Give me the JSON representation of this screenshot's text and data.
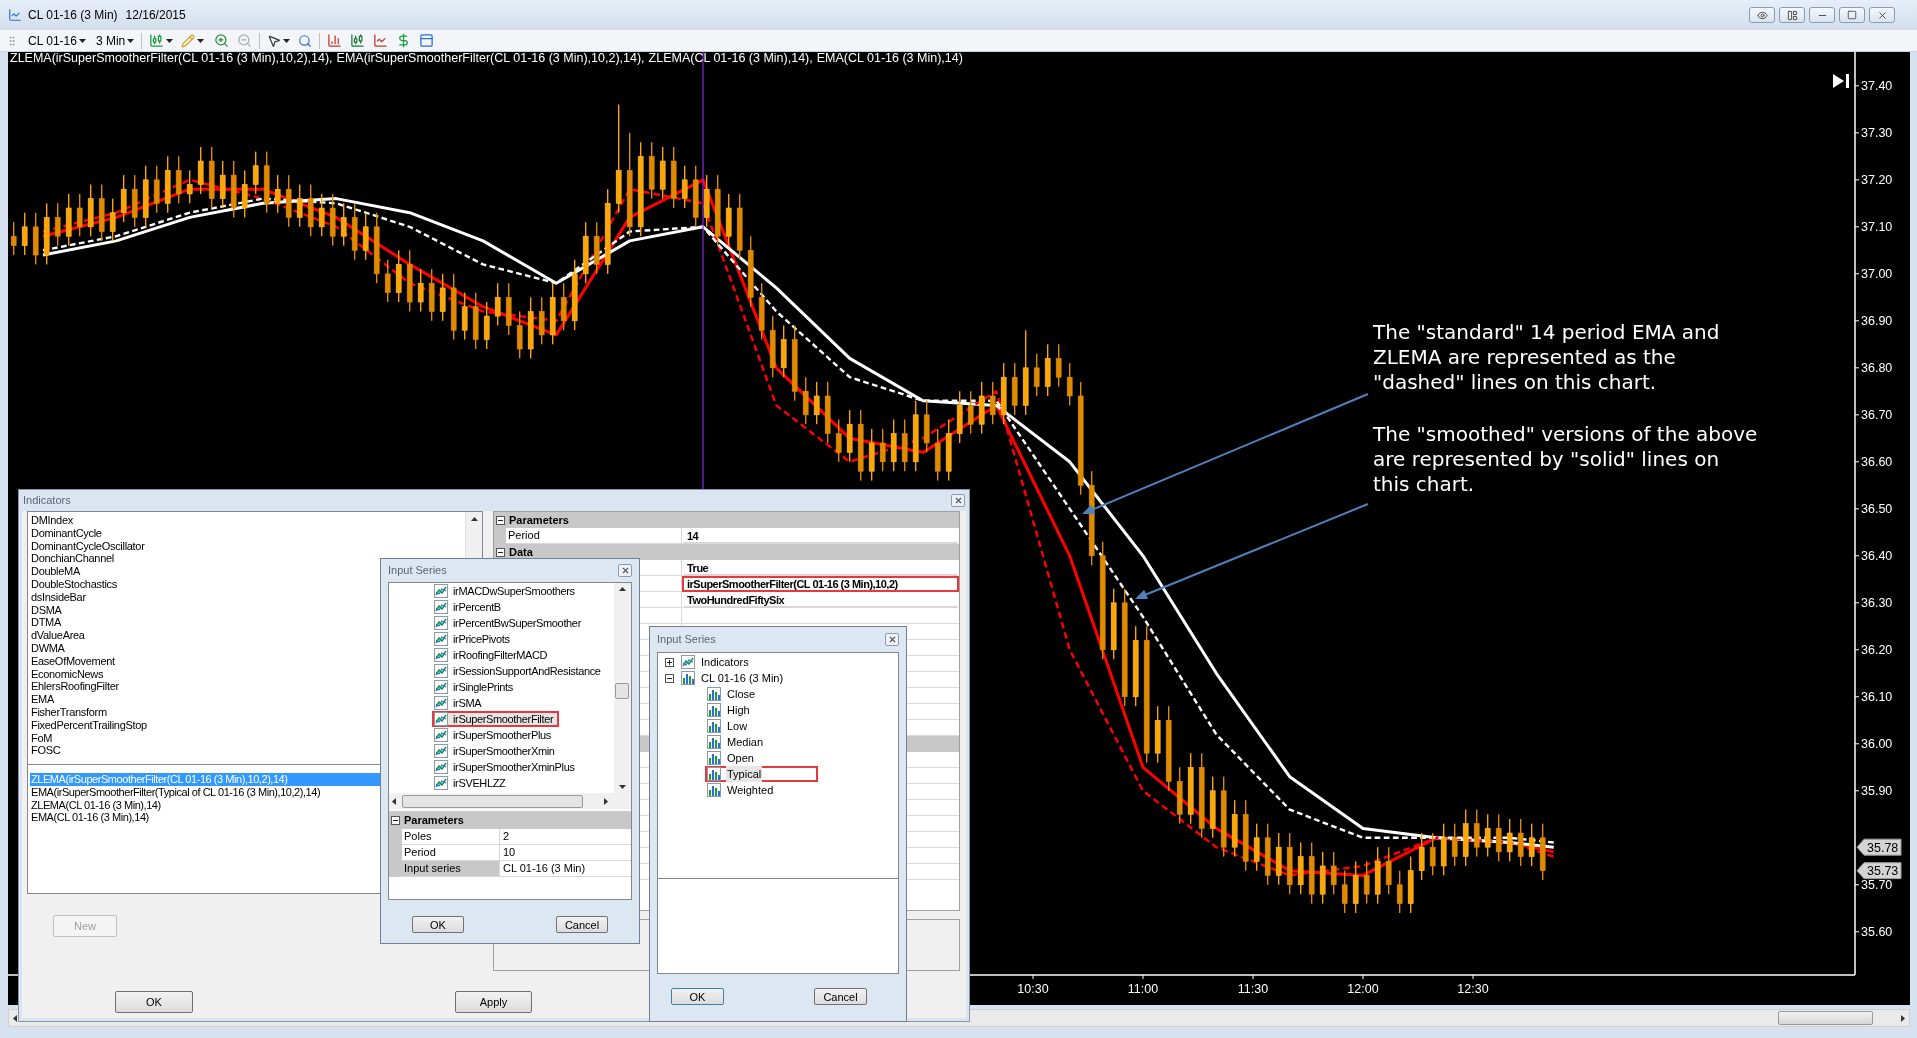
{
  "window": {
    "title": "CL 01-16 (3 Min)",
    "date": "12/16/2015"
  },
  "toolbar": {
    "instrument": "CL 01-16",
    "interval": "3 Min"
  },
  "chart": {
    "legend_separator": ",",
    "chart_data": {
      "type": "candlestick",
      "x": [
        352,
        355,
        358,
        361,
        364,
        367,
        370,
        373,
        376,
        379,
        382,
        385,
        388,
        391,
        394,
        397,
        400,
        403,
        406,
        409,
        412,
        415,
        418,
        421,
        424,
        427,
        430,
        433,
        436,
        439,
        442,
        445,
        448,
        451,
        454,
        457,
        460,
        463,
        466,
        469,
        472,
        475,
        478,
        481,
        484,
        487,
        490,
        493,
        496,
        499,
        502,
        505,
        508,
        511,
        514,
        517,
        520,
        523,
        526,
        529,
        532,
        535,
        538,
        541,
        544,
        547,
        550,
        553,
        556,
        559,
        562,
        565,
        568,
        571,
        574,
        577,
        580,
        583,
        586,
        589,
        592,
        595,
        598,
        601,
        604,
        607,
        610,
        613,
        616,
        619,
        622,
        625,
        628,
        631,
        634,
        637,
        640,
        643,
        646,
        649,
        652,
        655,
        658,
        661,
        664,
        667,
        670,
        673,
        676,
        679,
        682,
        685,
        688,
        691,
        694,
        697,
        700,
        703,
        706,
        709,
        712,
        715,
        718,
        721,
        724,
        727,
        730,
        733,
        736,
        739,
        742,
        745,
        748,
        751,
        754,
        757,
        760,
        763,
        766,
        769
      ],
      "ohlc": [
        [
          37.08,
          37.11,
          37.04,
          37.06
        ],
        [
          37.06,
          37.13,
          37.04,
          37.1
        ],
        [
          37.1,
          37.13,
          37.02,
          37.04
        ],
        [
          37.04,
          37.15,
          37.02,
          37.12
        ],
        [
          37.12,
          37.15,
          37.06,
          37.08
        ],
        [
          37.08,
          37.17,
          37.06,
          37.14
        ],
        [
          37.14,
          37.17,
          37.08,
          37.1
        ],
        [
          37.1,
          37.19,
          37.08,
          37.16
        ],
        [
          37.16,
          37.19,
          37.07,
          37.09
        ],
        [
          37.09,
          37.16,
          37.07,
          37.13
        ],
        [
          37.13,
          37.21,
          37.11,
          37.18
        ],
        [
          37.18,
          37.21,
          37.1,
          37.12
        ],
        [
          37.12,
          37.23,
          37.1,
          37.2
        ],
        [
          37.2,
          37.23,
          37.13,
          37.15
        ],
        [
          37.15,
          37.25,
          37.13,
          37.22
        ],
        [
          37.22,
          37.25,
          37.15,
          37.17
        ],
        [
          37.17,
          37.22,
          37.15,
          37.19
        ],
        [
          37.19,
          37.27,
          37.17,
          37.24
        ],
        [
          37.24,
          37.27,
          37.14,
          37.16
        ],
        [
          37.16,
          37.24,
          37.14,
          37.21
        ],
        [
          37.21,
          37.24,
          37.12,
          37.14
        ],
        [
          37.14,
          37.22,
          37.12,
          37.19
        ],
        [
          37.19,
          37.26,
          37.17,
          37.23
        ],
        [
          37.23,
          37.26,
          37.13,
          37.15
        ],
        [
          37.15,
          37.21,
          37.13,
          37.18
        ],
        [
          37.18,
          37.21,
          37.1,
          37.12
        ],
        [
          37.12,
          37.19,
          37.1,
          37.16
        ],
        [
          37.16,
          37.19,
          37.08,
          37.1
        ],
        [
          37.1,
          37.17,
          37.08,
          37.14
        ],
        [
          37.14,
          37.17,
          37.06,
          37.08
        ],
        [
          37.08,
          37.15,
          37.06,
          37.12
        ],
        [
          37.12,
          37.15,
          37.03,
          37.05
        ],
        [
          37.05,
          37.13,
          37.03,
          37.1
        ],
        [
          37.1,
          37.13,
          36.98,
          37.0
        ],
        [
          37.0,
          37.03,
          36.94,
          36.96
        ],
        [
          36.96,
          37.05,
          36.94,
          37.02
        ],
        [
          37.02,
          37.05,
          36.92,
          36.94
        ],
        [
          36.94,
          37.01,
          36.92,
          36.98
        ],
        [
          36.98,
          37.01,
          36.9,
          36.92
        ],
        [
          36.92,
          37.0,
          36.9,
          36.97
        ],
        [
          36.97,
          37.0,
          36.86,
          36.88
        ],
        [
          36.88,
          36.96,
          36.86,
          36.93
        ],
        [
          36.93,
          36.96,
          36.84,
          36.86
        ],
        [
          36.86,
          36.94,
          36.84,
          36.91
        ],
        [
          36.91,
          36.98,
          36.89,
          36.95
        ],
        [
          36.95,
          36.98,
          36.87,
          36.89
        ],
        [
          36.89,
          36.92,
          36.82,
          36.84
        ],
        [
          36.84,
          36.95,
          36.82,
          36.92
        ],
        [
          36.92,
          36.95,
          36.85,
          36.87
        ],
        [
          36.87,
          36.98,
          36.85,
          36.95
        ],
        [
          36.95,
          36.98,
          36.88,
          36.9
        ],
        [
          36.9,
          37.03,
          36.88,
          37.0
        ],
        [
          37.0,
          37.11,
          36.98,
          37.08
        ],
        [
          37.08,
          37.11,
          37.0,
          37.02
        ],
        [
          37.02,
          37.18,
          37.0,
          37.15
        ],
        [
          37.15,
          37.36,
          37.13,
          37.22
        ],
        [
          37.22,
          37.3,
          37.08,
          37.1
        ],
        [
          37.1,
          37.28,
          37.08,
          37.25
        ],
        [
          37.25,
          37.28,
          37.16,
          37.18
        ],
        [
          37.18,
          37.27,
          37.16,
          37.24
        ],
        [
          37.24,
          37.27,
          37.14,
          37.16
        ],
        [
          37.16,
          37.23,
          37.14,
          37.2
        ],
        [
          37.2,
          37.23,
          37.1,
          37.12
        ],
        [
          37.12,
          37.21,
          37.1,
          37.18
        ],
        [
          37.18,
          37.21,
          37.06,
          37.08
        ],
        [
          37.08,
          37.17,
          37.06,
          37.14
        ],
        [
          37.14,
          37.17,
          37.03,
          37.05
        ],
        [
          37.05,
          37.08,
          36.93,
          36.95
        ],
        [
          36.95,
          36.98,
          36.86,
          36.88
        ],
        [
          36.88,
          36.91,
          36.78,
          36.8
        ],
        [
          36.8,
          36.89,
          36.78,
          36.86
        ],
        [
          36.86,
          36.89,
          36.73,
          36.75
        ],
        [
          36.75,
          36.78,
          36.68,
          36.7
        ],
        [
          36.7,
          36.77,
          36.68,
          36.74
        ],
        [
          36.74,
          36.77,
          36.64,
          36.66
        ],
        [
          36.66,
          36.69,
          36.6,
          36.62
        ],
        [
          36.62,
          36.71,
          36.6,
          36.68
        ],
        [
          36.68,
          36.71,
          36.56,
          36.58
        ],
        [
          36.58,
          36.67,
          36.56,
          36.64
        ],
        [
          36.64,
          36.67,
          36.58,
          36.6
        ],
        [
          36.6,
          36.69,
          36.58,
          36.66
        ],
        [
          36.66,
          36.69,
          36.58,
          36.6
        ],
        [
          36.6,
          36.73,
          36.58,
          36.7
        ],
        [
          36.7,
          36.73,
          36.62,
          36.64
        ],
        [
          36.64,
          36.67,
          36.56,
          36.58
        ],
        [
          36.58,
          36.69,
          36.56,
          36.66
        ],
        [
          36.66,
          36.75,
          36.64,
          36.72
        ],
        [
          36.72,
          36.75,
          36.66,
          36.68
        ],
        [
          36.68,
          36.77,
          36.66,
          36.74
        ],
        [
          36.74,
          36.77,
          36.68,
          36.7
        ],
        [
          36.7,
          36.81,
          36.68,
          36.78
        ],
        [
          36.78,
          36.81,
          36.7,
          36.72
        ],
        [
          36.72,
          36.88,
          36.7,
          36.8
        ],
        [
          36.8,
          36.83,
          36.74,
          36.76
        ],
        [
          36.76,
          36.85,
          36.74,
          36.82
        ],
        [
          36.82,
          36.85,
          36.76,
          36.78
        ],
        [
          36.78,
          36.81,
          36.72,
          36.74
        ],
        [
          36.74,
          36.77,
          36.53,
          36.55
        ],
        [
          36.55,
          36.58,
          36.38,
          36.4
        ],
        [
          36.4,
          36.43,
          36.18,
          36.2
        ],
        [
          36.2,
          36.33,
          36.18,
          36.3
        ],
        [
          36.3,
          36.33,
          36.08,
          36.1
        ],
        [
          36.1,
          36.25,
          36.08,
          36.22
        ],
        [
          36.22,
          36.25,
          35.96,
          35.98
        ],
        [
          35.98,
          36.08,
          35.96,
          36.05
        ],
        [
          36.05,
          36.08,
          35.9,
          35.92
        ],
        [
          35.92,
          35.95,
          35.83,
          35.85
        ],
        [
          35.85,
          35.98,
          35.83,
          35.95
        ],
        [
          35.95,
          35.98,
          35.8,
          35.82
        ],
        [
          35.82,
          35.93,
          35.8,
          35.9
        ],
        [
          35.9,
          35.93,
          35.76,
          35.78
        ],
        [
          35.78,
          35.88,
          35.76,
          35.85
        ],
        [
          35.85,
          35.88,
          35.73,
          35.75
        ],
        [
          35.75,
          35.83,
          35.73,
          35.8
        ],
        [
          35.8,
          35.83,
          35.7,
          35.72
        ],
        [
          35.72,
          35.81,
          35.7,
          35.78
        ],
        [
          35.78,
          35.81,
          35.68,
          35.7
        ],
        [
          35.7,
          35.79,
          35.68,
          35.76
        ],
        [
          35.76,
          35.79,
          35.66,
          35.68
        ],
        [
          35.68,
          35.77,
          35.66,
          35.74
        ],
        [
          35.74,
          35.77,
          35.68,
          35.7
        ],
        [
          35.7,
          35.73,
          35.64,
          35.66
        ],
        [
          35.66,
          35.75,
          35.64,
          35.72
        ],
        [
          35.72,
          35.75,
          35.66,
          35.68
        ],
        [
          35.68,
          35.78,
          35.66,
          35.75
        ],
        [
          35.75,
          35.78,
          35.68,
          35.7
        ],
        [
          35.7,
          35.73,
          35.64,
          35.66
        ],
        [
          35.66,
          35.76,
          35.64,
          35.73
        ],
        [
          35.73,
          35.81,
          35.71,
          35.78
        ],
        [
          35.78,
          35.81,
          35.72,
          35.74
        ],
        [
          35.74,
          35.83,
          35.72,
          35.8
        ],
        [
          35.8,
          35.83,
          35.74,
          35.76
        ],
        [
          35.76,
          35.86,
          35.74,
          35.83
        ],
        [
          35.83,
          35.86,
          35.76,
          35.78
        ],
        [
          35.78,
          35.85,
          35.76,
          35.82
        ],
        [
          35.82,
          35.85,
          35.75,
          35.77
        ],
        [
          35.77,
          35.84,
          35.75,
          35.81
        ],
        [
          35.81,
          35.84,
          35.74,
          35.76
        ],
        [
          35.76,
          35.83,
          35.74,
          35.8
        ],
        [
          35.8,
          35.83,
          35.71,
          35.73
        ]
      ],
      "xlim": [
        350.45,
        854.18
      ],
      "ylim": [
        35.508,
        37.472
      ],
      "xticks": [
        {
          "value": 630,
          "label": "10:30"
        },
        {
          "value": 660,
          "label": "11:00"
        },
        {
          "value": 690,
          "label": "11:30"
        },
        {
          "value": 720,
          "label": "12:00"
        },
        {
          "value": 750,
          "label": "12:30"
        }
      ],
      "yticks": [
        {
          "value": 37.4,
          "label": "37.40"
        },
        {
          "value": 37.3,
          "label": "37.30"
        },
        {
          "value": 37.2,
          "label": "37.20"
        },
        {
          "value": 37.1,
          "label": "37.10"
        },
        {
          "value": 37.0,
          "label": "37.00"
        },
        {
          "value": 36.9,
          "label": "36.90"
        },
        {
          "value": 36.8,
          "label": "36.80"
        },
        {
          "value": 36.7,
          "label": "36.70"
        },
        {
          "value": 36.6,
          "label": "36.60"
        },
        {
          "value": 36.5,
          "label": "36.50"
        },
        {
          "value": 36.4,
          "label": "36.40"
        },
        {
          "value": 36.3,
          "label": "36.30"
        },
        {
          "value": 36.2,
          "label": "36.20"
        },
        {
          "value": 36.1,
          "label": "36.10"
        },
        {
          "value": 36.0,
          "label": "36.00"
        },
        {
          "value": 35.9,
          "label": "35.90"
        },
        {
          "value": 35.7,
          "label": "35.70"
        },
        {
          "value": 35.6,
          "label": "35.60"
        }
      ],
      "annotations": [
        "35.78",
        "35.73"
      ]
    },
    "overlay": {
      "chart_data": {
        "type": "line",
        "x": [
          360,
          380,
          400,
          420,
          440,
          460,
          480,
          500,
          520,
          540,
          560,
          580,
          600,
          620,
          640,
          660,
          680,
          700,
          720,
          740,
          760,
          772
        ],
        "series": [
          {
            "name": "ZLEMA(irSuperSmootherFilter(CL 01-16 (3 Min),10,2),14)",
            "color": "#ff0000",
            "line_style": "solid",
            "values": [
              37.08,
              37.12,
              37.18,
              37.18,
              37.12,
              37.02,
              36.93,
              36.87,
              37.12,
              37.2,
              36.8,
              36.65,
              36.62,
              36.72,
              36.4,
              35.95,
              35.82,
              35.73,
              35.72,
              35.8,
              35.79,
              35.77
            ]
          },
          {
            "name": "EMA(irSuperSmootherFilter(CL 01-16 (3 Min),10,2),14)",
            "color": "#ffffff",
            "line_style": "solid",
            "values": [
              37.04,
              37.07,
              37.12,
              37.15,
              37.16,
              37.13,
              37.07,
              36.98,
              37.07,
              37.1,
              36.97,
              36.82,
              36.73,
              36.72,
              36.6,
              36.4,
              36.15,
              35.93,
              35.82,
              35.8,
              35.79,
              35.78
            ]
          },
          {
            "name": "ZLEMA(CL 01-16 (3 Min),14)",
            "color": "#ff0000",
            "line_style": "dashed",
            "values": [
              37.09,
              37.13,
              37.2,
              37.16,
              37.1,
              36.98,
              36.92,
              36.9,
              37.18,
              37.15,
              36.72,
              36.6,
              36.65,
              36.75,
              36.2,
              35.9,
              35.78,
              35.72,
              35.74,
              35.8,
              35.79,
              35.76
            ]
          },
          {
            "name": "EMA(CL 01-16 (3 Min),14)",
            "color": "#ffffff",
            "line_style": "dashed",
            "values": [
              37.05,
              37.08,
              37.13,
              37.16,
              37.15,
              37.1,
              37.02,
              36.98,
              37.09,
              37.1,
              36.92,
              36.78,
              36.73,
              36.73,
              36.5,
              36.27,
              36.02,
              35.86,
              35.8,
              35.8,
              35.8,
              35.79
            ]
          }
        ],
        "xlim": [
          350.45,
          854.18
        ],
        "ylim": [
          35.508,
          37.472
        ]
      }
    },
    "note": [
      "The \"standard\" 14 period EMA and ZLEMA are represented as the \"dashed\" lines on this chart.",
      "The \"smoothed\" versions of the above are represented by \"solid\" lines on this chart."
    ]
  },
  "indicators_dialog": {
    "title": "Indicators",
    "available": [
      {
        "label": "DMIndex",
        "selected": false
      },
      {
        "label": "DominantCycle",
        "selected": false
      },
      {
        "label": "DominantCycleOscillator",
        "selected": false
      },
      {
        "label": "DonchianChannel",
        "selected": false
      },
      {
        "label": "DoubleMA",
        "selected": false
      },
      {
        "label": "DoubleStochastics",
        "selected": false
      },
      {
        "label": "dsInsideBar",
        "selected": false
      },
      {
        "label": "DSMA",
        "selected": false
      },
      {
        "label": "DTMA",
        "selected": false
      },
      {
        "label": "dValueArea",
        "selected": false
      },
      {
        "label": "DWMA",
        "selected": false
      },
      {
        "label": "EaseOfMovement",
        "selected": false
      },
      {
        "label": "EconomicNews",
        "selected": false
      },
      {
        "label": "EhlersRoofingFilter",
        "selected": false
      },
      {
        "label": "EMA",
        "selected": false
      },
      {
        "label": "FisherTransform",
        "selected": false
      },
      {
        "label": "FixedPercentTrailingStop",
        "selected": false
      },
      {
        "label": "FoM",
        "selected": false
      },
      {
        "label": "FOSC",
        "selected": false
      }
    ],
    "applied": [
      {
        "label": "ZLEMA(irSuperSmootherFilter(CL 01-16 (3 Min),10,2),14)",
        "selected": true
      },
      {
        "label": "EMA(irSuperSmootherFilter(Typical of CL 01-16 (3 Min),10,2),14)",
        "selected": false
      },
      {
        "label": "ZLEMA(CL 01-16 (3 Min),14)",
        "selected": false
      },
      {
        "label": "EMA(CL 01-16 (3 Min),14)",
        "selected": false
      }
    ],
    "properties": [
      {
        "kind": "header",
        "label": "Parameters",
        "expanded": true
      },
      {
        "kind": "row",
        "label": "Period",
        "value": "14",
        "outlined": false
      },
      {
        "kind": "header",
        "label": "Data",
        "expanded": true
      },
      {
        "kind": "row",
        "value": "True",
        "outlined": false
      },
      {
        "kind": "row",
        "value": "irSuperSmootherFilter(CL 01-16 (3 Min),10,2)",
        "outlined": true
      },
      {
        "kind": "row",
        "value": "TwoHundredFiftySix",
        "outlined": false
      }
    ],
    "new_button": {
      "label": "New",
      "disabled": true
    },
    "ok_button": "OK",
    "apply_button": "Apply"
  },
  "input_series_dialog": {
    "title": "Input Series",
    "items": [
      {
        "label": "irMACDwSuperSmoothers",
        "selected": false,
        "outlined": false
      },
      {
        "label": "irPercentB",
        "selected": false,
        "outlined": false
      },
      {
        "label": "irPercentBwSuperSmoother",
        "selected": false,
        "outlined": false
      },
      {
        "label": "irPricePivots",
        "selected": false,
        "outlined": false
      },
      {
        "label": "irRoofingFilterMACD",
        "selected": false,
        "outlined": false
      },
      {
        "label": "irSessionSupportAndResistance",
        "selected": false,
        "outlined": false
      },
      {
        "label": "irSinglePrints",
        "selected": false,
        "outlined": false
      },
      {
        "label": "irSMA",
        "selected": false,
        "outlined": false
      },
      {
        "label": "irSuperSmootherFilter",
        "selected": true,
        "outlined": true
      },
      {
        "label": "irSuperSmootherPlus",
        "selected": false,
        "outlined": false
      },
      {
        "label": "irSuperSmootherXmin",
        "selected": false,
        "outlined": false
      },
      {
        "label": "irSuperSmootherXminPlus",
        "selected": false,
        "outlined": false
      },
      {
        "label": "irSVEHLZZ",
        "selected": false,
        "outlined": false
      }
    ],
    "parameters_header": {
      "label": "Parameters",
      "expanded": true
    },
    "parameters": [
      {
        "label": "Poles",
        "value": "2"
      },
      {
        "label": "Period",
        "value": "10"
      },
      {
        "label": "Input series",
        "value": "CL 01-16 (3 Min)"
      }
    ],
    "ok_button": "OK",
    "cancel_button": "Cancel"
  },
  "series_dialog": {
    "title": "Input Series",
    "tree": [
      {
        "label": "Indicators",
        "kind": "indicators",
        "expanded": false,
        "selected": false,
        "outlined": false
      },
      {
        "label": "CL 01-16 (3 Min)",
        "kind": "series",
        "expanded": true,
        "selected": false,
        "outlined": false,
        "children": [
          {
            "label": "Close",
            "selected": false,
            "outlined": false
          },
          {
            "label": "High",
            "selected": false,
            "outlined": false
          },
          {
            "label": "Low",
            "selected": false,
            "outlined": false
          },
          {
            "label": "Median",
            "selected": false,
            "outlined": false
          },
          {
            "label": "Open",
            "selected": false,
            "outlined": false
          },
          {
            "label": "Typical",
            "selected": true,
            "outlined": true
          },
          {
            "label": "Weighted",
            "selected": false,
            "outlined": false
          }
        ]
      }
    ],
    "ok_button": "OK",
    "cancel_button": "Cancel"
  }
}
